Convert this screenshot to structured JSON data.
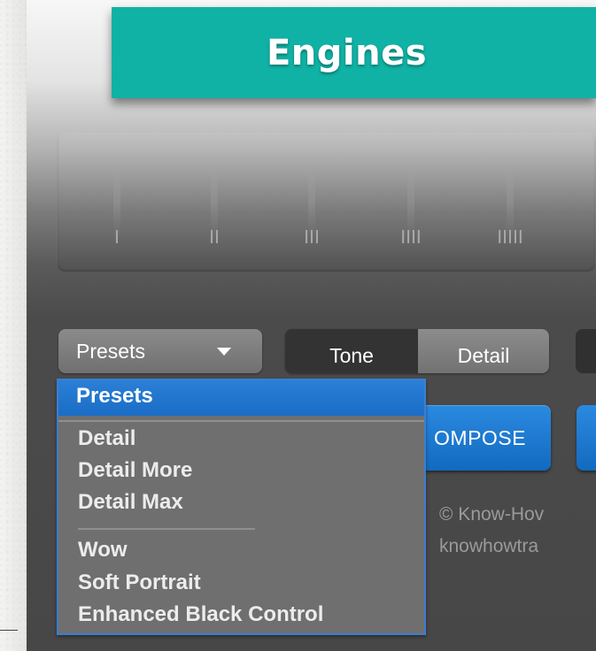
{
  "header": {
    "title": "Engines"
  },
  "engines": {
    "labels": [
      "I",
      "II",
      "III",
      "IIII",
      "IIIII"
    ]
  },
  "toolbar": {
    "presets_label": "Presets",
    "tabs": [
      {
        "label": "Tone"
      },
      {
        "label": "Detail"
      }
    ],
    "compose_label": "OMPOSE"
  },
  "dropdown": {
    "selected": "Presets",
    "items": [
      {
        "label": "Detail"
      },
      {
        "label": "Detail More"
      },
      {
        "label": "Detail Max"
      },
      {
        "label": "Wow"
      },
      {
        "label": "Soft Portrait"
      },
      {
        "label": "Enhanced Black Control"
      }
    ]
  },
  "footer": {
    "copyright_line1": "© Know-Hov",
    "copyright_line2": "knowhowtra"
  },
  "colors": {
    "banner": "#10b2a5",
    "accent_blue": "#1a6dc6",
    "menu_bg": "#6f6f6f",
    "panel_dark": "#474747"
  }
}
